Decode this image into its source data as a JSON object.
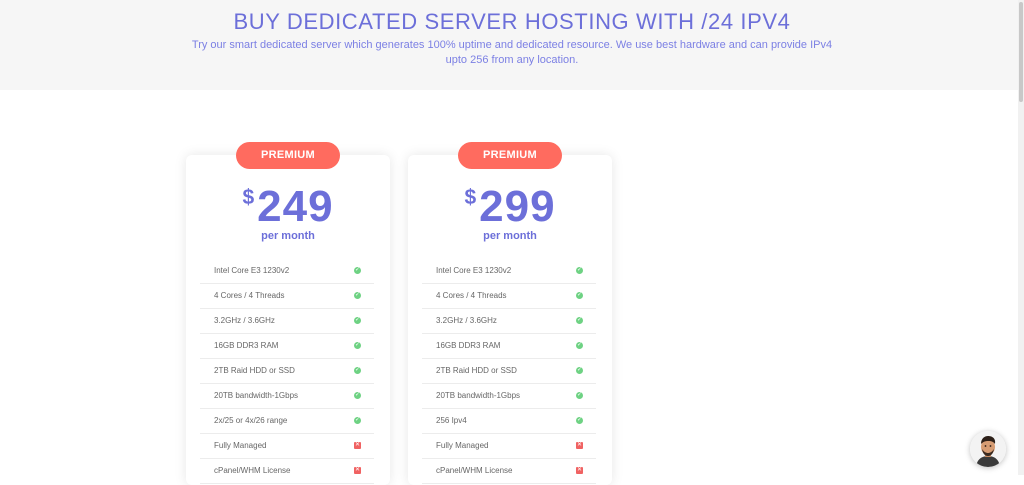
{
  "hero": {
    "title": "BUY DEDICATED SERVER HOSTING WITH /24 IPV4",
    "subtitle": "Try our smart dedicated server which generates 100% uptime and dedicated resource. We use best hardware and can provide IPv4 upto 256 from any location."
  },
  "plans": [
    {
      "badge": "PREMIUM",
      "currency": "$",
      "price": "249",
      "period": "per month",
      "features": [
        {
          "label": "Intel Core E3 1230v2",
          "included": true
        },
        {
          "label": "4 Cores / 4 Threads",
          "included": true
        },
        {
          "label": "3.2GHz / 3.6GHz",
          "included": true
        },
        {
          "label": "16GB DDR3 RAM",
          "included": true
        },
        {
          "label": "2TB Raid HDD or SSD",
          "included": true
        },
        {
          "label": "20TB bandwidth-1Gbps",
          "included": true
        },
        {
          "label": "2x/25 or 4x/26 range",
          "included": true
        },
        {
          "label": "Fully Managed",
          "included": false
        },
        {
          "label": "cPanel/WHM License",
          "included": false
        }
      ]
    },
    {
      "badge": "PREMIUM",
      "currency": "$",
      "price": "299",
      "period": "per month",
      "features": [
        {
          "label": "Intel Core E3 1230v2",
          "included": true
        },
        {
          "label": "4 Cores / 4 Threads",
          "included": true
        },
        {
          "label": "3.2GHz / 3.6GHz",
          "included": true
        },
        {
          "label": "16GB DDR3 RAM",
          "included": true
        },
        {
          "label": "2TB Raid HDD or SSD",
          "included": true
        },
        {
          "label": "20TB bandwidth-1Gbps",
          "included": true
        },
        {
          "label": "256 Ipv4",
          "included": true
        },
        {
          "label": "Fully Managed",
          "included": false
        },
        {
          "label": "cPanel/WHM License",
          "included": false
        }
      ]
    }
  ],
  "icons": {
    "check": "✓",
    "cross": "✕"
  },
  "colors": {
    "accent": "#6c6fd9",
    "badge": "#ff6b5f",
    "check": "#6ed283",
    "cross": "#f06262",
    "hero_background": "#f6f6f6"
  }
}
